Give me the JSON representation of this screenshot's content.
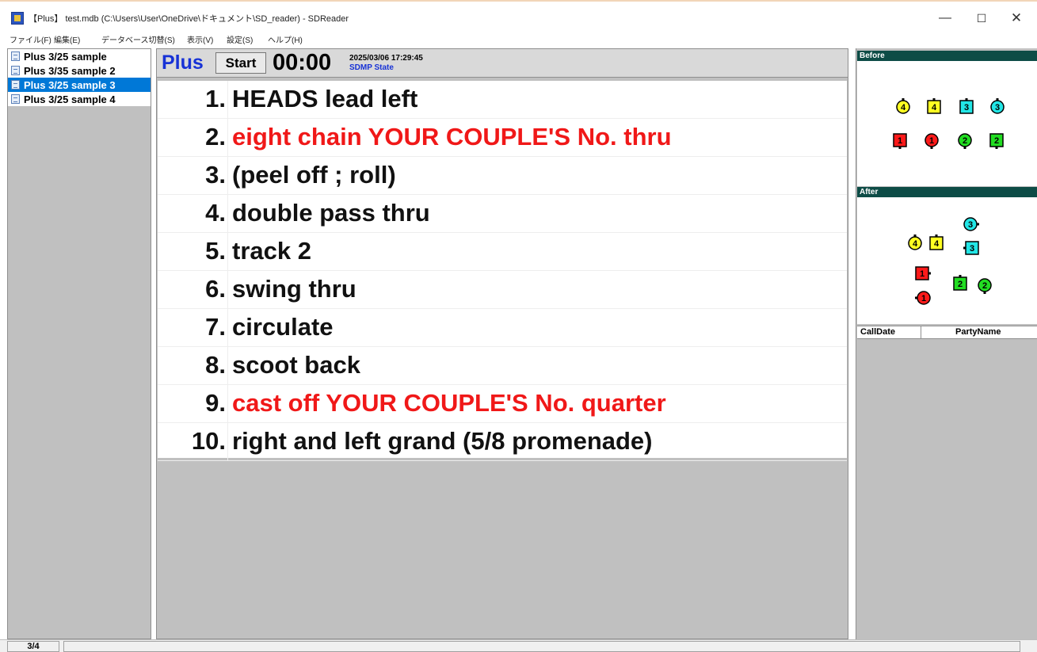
{
  "window": {
    "title": "【Plus】 test.mdb (C:\\Users\\User\\OneDrive\\ドキュメント\\SD_reader) - SDReader",
    "minimize": "—",
    "maximize": "☐",
    "close": "✕"
  },
  "menu": [
    "ファイル(F)",
    "編集(E)",
    "データベース切替(S)",
    "表示(V)",
    "設定(S)",
    "ヘルプ(H)"
  ],
  "sidebar": {
    "items": [
      {
        "label": "Plus 3/25 sample",
        "selected": false
      },
      {
        "label": "Plus 3/35 sample 2",
        "selected": false
      },
      {
        "label": "Plus 3/25 sample 3",
        "selected": true
      },
      {
        "label": "Plus 3/25 sample 4",
        "selected": false
      }
    ]
  },
  "header": {
    "level": "Plus",
    "start_label": "Start",
    "timer": "00:00",
    "datetime": "2025/03/06 17:29:45",
    "state": "SDMP State"
  },
  "calls": [
    {
      "num": "1.",
      "text": "HEADS lead left",
      "highlight": false
    },
    {
      "num": "2.",
      "text": "eight chain YOUR COUPLE'S No. thru",
      "highlight": true
    },
    {
      "num": "3.",
      "text": "(peel off ; roll)",
      "highlight": false
    },
    {
      "num": "4.",
      "text": "double pass thru",
      "highlight": false
    },
    {
      "num": "5.",
      "text": "track 2",
      "highlight": false
    },
    {
      "num": "6.",
      "text": "swing thru",
      "highlight": false
    },
    {
      "num": "7.",
      "text": "circulate",
      "highlight": false
    },
    {
      "num": "8.",
      "text": "scoot back",
      "highlight": false
    },
    {
      "num": "9.",
      "text": "cast off YOUR COUPLE'S No. quarter",
      "highlight": true
    },
    {
      "num": "10.",
      "text": "right and left grand  (5/8 promenade)",
      "highlight": false
    }
  ],
  "right": {
    "before_label": "Before",
    "after_label": "After",
    "col_calldate": "CallDate",
    "col_partyname": "PartyName"
  },
  "colors": {
    "couple1": "#ff1a1a",
    "couple2": "#22dd22",
    "couple3": "#22e6e6",
    "couple4": "#ffff22",
    "highlight_text": "#f01818",
    "level_text": "#1732d6",
    "selection": "#0078d7"
  },
  "status": {
    "count": "3/4"
  }
}
